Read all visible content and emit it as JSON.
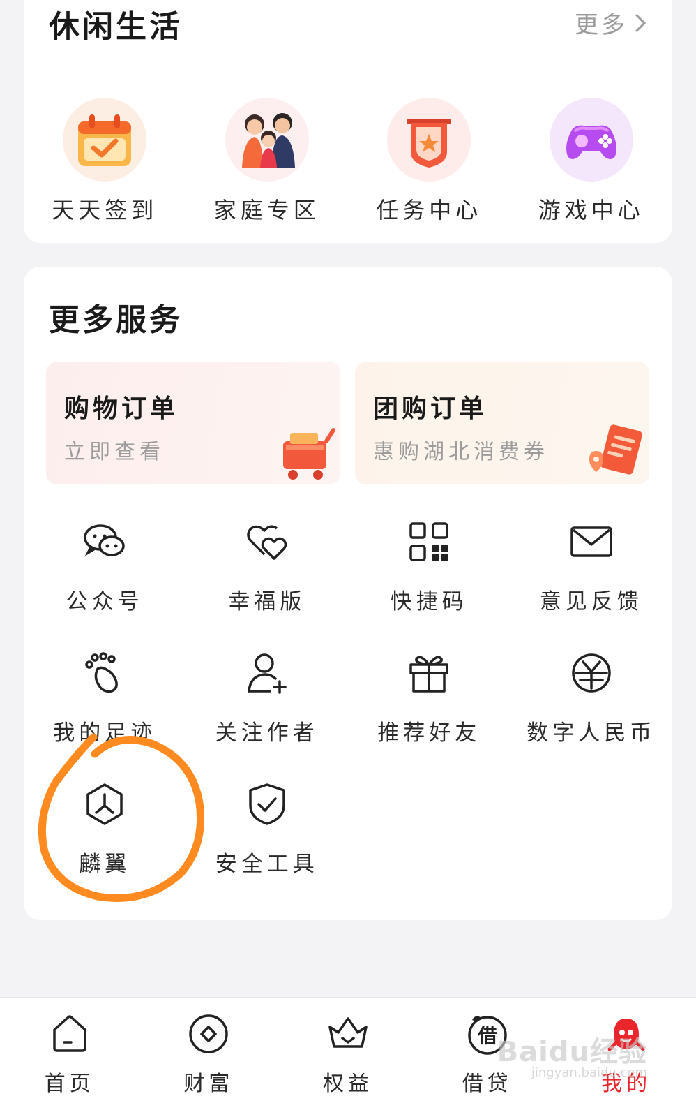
{
  "leisure": {
    "title": "休闲生活",
    "more_label": "更多",
    "items": [
      {
        "label": "天天签到",
        "icon": "calendar-check-icon"
      },
      {
        "label": "家庭专区",
        "icon": "family-icon"
      },
      {
        "label": "任务中心",
        "icon": "task-banner-icon"
      },
      {
        "label": "游戏中心",
        "icon": "gamepad-icon"
      }
    ]
  },
  "services": {
    "title": "更多服务",
    "orders": [
      {
        "title": "购物订单",
        "subtitle": "立即查看",
        "icon": "shopping-cart-icon"
      },
      {
        "title": "团购订单",
        "subtitle": "惠购湖北消费券",
        "icon": "coupon-icon"
      }
    ],
    "items": [
      {
        "label": "公众号",
        "icon": "wechat-icon"
      },
      {
        "label": "幸福版",
        "icon": "hearts-icon"
      },
      {
        "label": "快捷码",
        "icon": "qr-code-icon"
      },
      {
        "label": "意见反馈",
        "icon": "mail-icon"
      },
      {
        "label": "我的足迹",
        "icon": "footprint-icon"
      },
      {
        "label": "关注作者",
        "icon": "follow-user-icon"
      },
      {
        "label": "推荐好友",
        "icon": "gift-icon"
      },
      {
        "label": "数字人民币",
        "icon": "digital-yuan-icon"
      },
      {
        "label": "麟翼",
        "icon": "hexagon-wing-icon"
      },
      {
        "label": "安全工具",
        "icon": "shield-check-icon"
      }
    ]
  },
  "tabbar": {
    "items": [
      {
        "label": "首页",
        "icon": "home-icon"
      },
      {
        "label": "财富",
        "icon": "wealth-icon"
      },
      {
        "label": "权益",
        "icon": "crown-icon"
      },
      {
        "label": "借贷",
        "icon": "loan-icon",
        "icon_text": "借"
      },
      {
        "label": "我的",
        "icon": "mascot-icon",
        "active": true
      }
    ]
  },
  "watermark": {
    "text": "Baidu经验",
    "sub": "jingyan.baidu.com"
  },
  "colors": {
    "accent_red": "#e8262c",
    "annotation_orange": "#ff8a1f"
  }
}
